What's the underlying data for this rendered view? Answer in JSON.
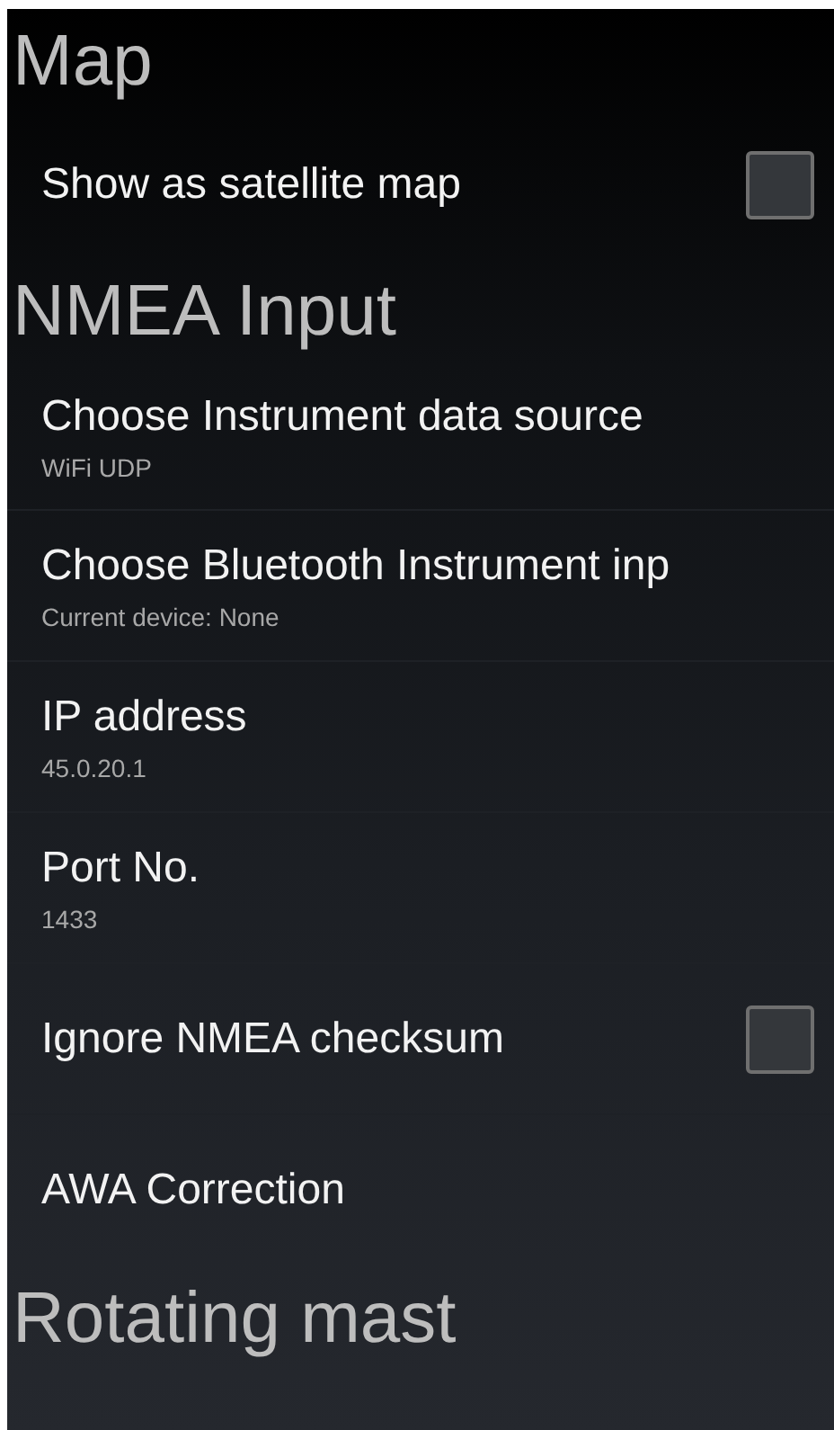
{
  "sections": [
    {
      "title": "Map",
      "items": [
        {
          "kind": "checkbox",
          "title": "Show as satellite map",
          "checked": false
        }
      ]
    },
    {
      "title": "NMEA Input",
      "items": [
        {
          "kind": "text",
          "title": "Choose Instrument data source",
          "summary": "WiFi UDP"
        },
        {
          "kind": "text",
          "title": "Choose Bluetooth Instrument inp",
          "summary": "Current device: None"
        },
        {
          "kind": "text",
          "title": "IP address",
          "summary": "45.0.20.1"
        },
        {
          "kind": "text",
          "title": "Port No.",
          "summary": "1433"
        },
        {
          "kind": "checkbox",
          "title": "Ignore NMEA checksum",
          "checked": false
        },
        {
          "kind": "text",
          "title": "AWA Correction"
        }
      ]
    },
    {
      "title": "Rotating mast"
    }
  ]
}
